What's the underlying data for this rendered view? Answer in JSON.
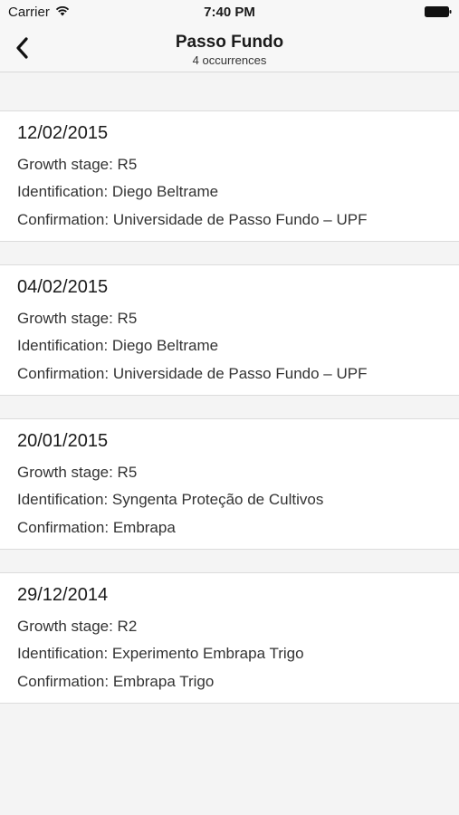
{
  "status": {
    "carrier": "Carrier",
    "time": "7:40 PM"
  },
  "nav": {
    "title": "Passo Fundo",
    "subtitle": "4 occurrences"
  },
  "occurrences": [
    {
      "date": "12/02/2015",
      "growth": "Growth stage: R5",
      "identification": "Identification: Diego Beltrame",
      "confirmation": "Confirmation: Universidade de Passo Fundo – UPF"
    },
    {
      "date": "04/02/2015",
      "growth": "Growth stage: R5",
      "identification": "Identification: Diego Beltrame",
      "confirmation": "Confirmation: Universidade de Passo Fundo – UPF"
    },
    {
      "date": "20/01/2015",
      "growth": "Growth stage: R5",
      "identification": "Identification: Syngenta Proteção de Cultivos",
      "confirmation": "Confirmation: Embrapa"
    },
    {
      "date": "29/12/2014",
      "growth": "Growth stage: R2",
      "identification": "Identification: Experimento Embrapa Trigo",
      "confirmation": "Confirmation: Embrapa Trigo"
    }
  ]
}
